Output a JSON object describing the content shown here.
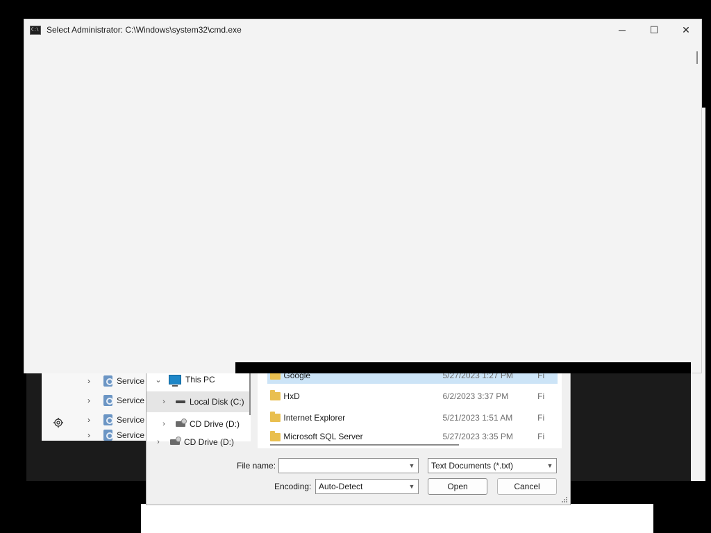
{
  "cmd": {
    "title": "Select Administrator: C:\\Windows\\system32\\cmd.exe",
    "minimize": "─",
    "maximize": "☐",
    "close": "✕"
  },
  "settings": {
    "items": [
      "Service",
      "Service",
      "Service",
      "Service"
    ],
    "gear_icon": "gear-icon"
  },
  "dialog": {
    "nav": [
      {
        "label": "This PC",
        "chevron": "⌄",
        "icon": "pc-icon"
      },
      {
        "label": "Local Disk (C:)",
        "chevron": "›",
        "icon": "disk-icon"
      },
      {
        "label": "CD Drive (D:)",
        "chevron": "›",
        "icon": "cd-icon"
      },
      {
        "label": "CD Drive (D:)",
        "chevron": "›",
        "icon": "cd-icon"
      }
    ],
    "files": [
      {
        "name": "Google",
        "date": "5/27/2023 1:27 PM",
        "type": "Fi"
      },
      {
        "name": "HxD",
        "date": "6/2/2023 3:37 PM",
        "type": "Fi"
      },
      {
        "name": "Internet Explorer",
        "date": "5/21/2023 1:51 AM",
        "type": "Fi"
      },
      {
        "name": "Microsoft SQL Server",
        "date": "5/27/2023 3:35 PM",
        "type": "Fi"
      }
    ],
    "file_name_label": "File name:",
    "file_name_value": "",
    "file_type_value": "Text Documents (*.txt)",
    "encoding_label": "Encoding:",
    "encoding_value": "Auto-Detect",
    "open_label": "Open",
    "cancel_label": "Cancel"
  }
}
